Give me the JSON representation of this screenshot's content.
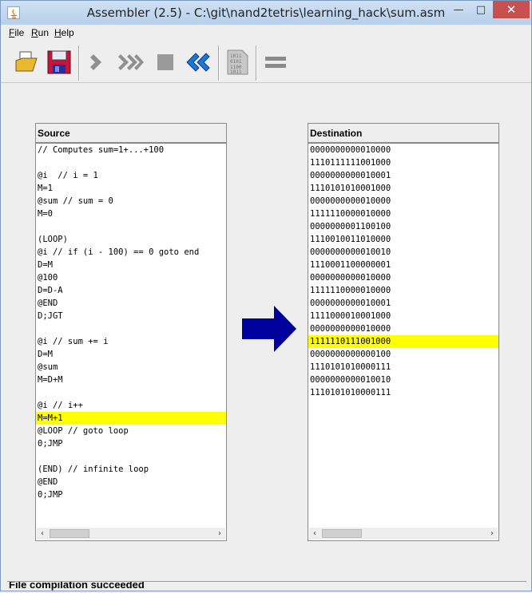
{
  "window": {
    "title": "Assembler (2.5) - C:\\git\\nand2tetris\\learning_hack\\sum.asm",
    "minimize_glyph": "—",
    "maximize_glyph": "□",
    "close_glyph": "✕"
  },
  "menu": {
    "file": {
      "u": "F",
      "rest": "ile"
    },
    "run": {
      "u": "R",
      "rest": "un"
    },
    "help": {
      "u": "H",
      "rest": "elp"
    }
  },
  "toolbar": {
    "icons": [
      "open-file-icon",
      "save-file-icon",
      "single-step-icon",
      "fast-forward-icon",
      "stop-icon",
      "rewind-icon",
      "load-compare-file-icon",
      "equals-compare-icon"
    ],
    "binary_icon_text": [
      "1011",
      "0101",
      "1100",
      "1011"
    ]
  },
  "source": {
    "title": "Source",
    "lines": [
      "// Computes sum=1+...+100",
      "",
      "@i  // i = 1",
      "M=1",
      "@sum // sum = 0",
      "M=0",
      "",
      "(LOOP)",
      "@i // if (i - 100) == 0 goto end",
      "D=M",
      "@100",
      "D=D-A",
      "@END",
      "D;JGT",
      "",
      "@i // sum += i",
      "D=M",
      "@sum",
      "M=D+M",
      "",
      "@i // i++",
      "M=M+1",
      "@LOOP // goto loop",
      "0;JMP",
      "",
      "(END) // infinite loop",
      "@END",
      "0;JMP"
    ],
    "highlight_index": 21
  },
  "destination": {
    "title": "Destination",
    "lines": [
      "0000000000010000",
      "1110111111001000",
      "0000000000010001",
      "1110101010001000",
      "0000000000010000",
      "1111110000010000",
      "0000000001100100",
      "1110010011010000",
      "0000000000010010",
      "1110001100000001",
      "0000000000010000",
      "1111110000010000",
      "0000000000010001",
      "1111000010001000",
      "0000000000010000",
      "1111110111001000",
      "0000000000000100",
      "1110101010000111",
      "0000000000010010",
      "1110101010000111"
    ],
    "highlight_index": 15
  },
  "scrollbar": {
    "left_glyph": "‹",
    "right_glyph": "›"
  },
  "status": {
    "text": "File compilation succeeded"
  },
  "colors": {
    "highlight": "#ffff00",
    "arrow": "#00009c",
    "close_button": "#c75050"
  }
}
